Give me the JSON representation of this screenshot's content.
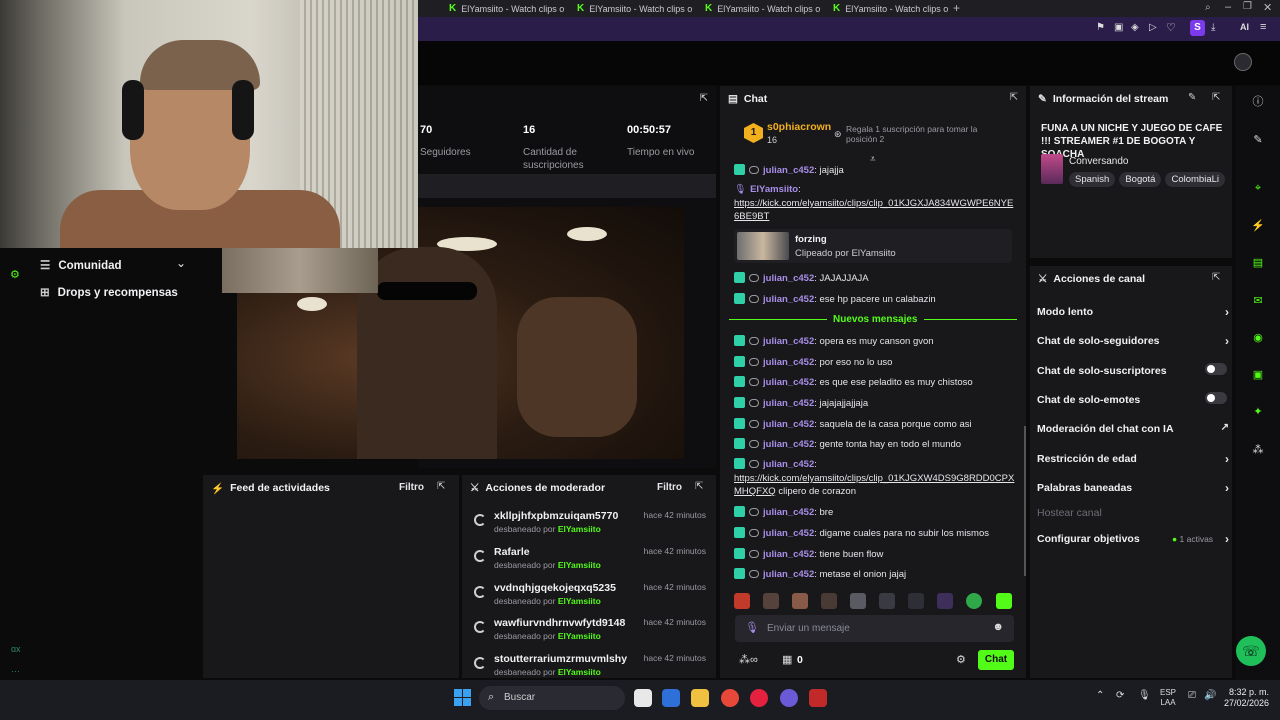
{
  "browser": {
    "tabs": [
      {
        "title": "ElYamsiito - Watch clips o"
      },
      {
        "title": "ElYamsiito - Watch clips o"
      },
      {
        "title": "ElYamsiito - Watch clips o"
      },
      {
        "title": "ElYamsiito - Watch clips o"
      }
    ],
    "new_tab": "+",
    "ai_label": "AI",
    "profile_initial": "S"
  },
  "stats": {
    "followers_value": "70",
    "followers_label": "Seguidores",
    "subs_value": "16",
    "subs_label": "Cantidad de suscripciones",
    "time_value": "00:50:57",
    "time_label": "Tiempo en vivo"
  },
  "sidebar": {
    "community": "Comunidad",
    "drops": "Drops y recompensas"
  },
  "activity": {
    "title": "Feed de actividades",
    "filter": "Filtro"
  },
  "mod_actions": {
    "title": "Acciones de moderador",
    "filter": "Filtro",
    "rows": [
      {
        "name": "xkllpjhfxpbmzuiqam5770",
        "by": "desbaneado por",
        "mod": "ElYamsiito",
        "time": "hace 42 minutos"
      },
      {
        "name": "Rafarle",
        "by": "desbaneado por",
        "mod": "ElYamsiito",
        "time": "hace 42 minutos"
      },
      {
        "name": "vvdnqhjgqekojeqxq5235",
        "by": "desbaneado por",
        "mod": "ElYamsiito",
        "time": "hace 42 minutos"
      },
      {
        "name": "wawfiurvndhrnvwfytd9148",
        "by": "desbaneado por",
        "mod": "ElYamsiito",
        "time": "hace 42 minutos"
      },
      {
        "name": "stoutterrariumzrmuvmlshy",
        "by": "desbaneado por",
        "mod": "ElYamsiito",
        "time": "hace 42 minutos"
      }
    ]
  },
  "chat": {
    "title": "Chat",
    "top_gifter": {
      "rank": "1",
      "name": "s0phiacrown",
      "count": "16",
      "note": "Regala 1 suscripción para tomar la posición 2"
    },
    "pre_messages": [
      {
        "user": "julian_c452",
        "text": "jajajja"
      }
    ],
    "link_message": {
      "user": "ElYamsiito",
      "text": "https://kick.com/elyamsiito/clips/clip_01KJGXJA834WGWPE6NYE6BE9BT"
    },
    "clip_card": {
      "title": "forzing",
      "sub": "Clipeado por ElYamsiito"
    },
    "messages_a": [
      {
        "user": "julian_c452",
        "text": "JAJAJJAJA"
      },
      {
        "user": "julian_c452",
        "text": "ese hp pacere un calabazin"
      }
    ],
    "new_divider": "Nuevos mensajes",
    "messages_b": [
      {
        "user": "julian_c452",
        "text": "opera es muy canson gvon"
      },
      {
        "user": "julian_c452",
        "text": "por eso no lo uso"
      },
      {
        "user": "julian_c452",
        "text": "es que ese peladito es muy chistoso"
      },
      {
        "user": "julian_c452",
        "text": "jajajajjajjaja"
      },
      {
        "user": "julian_c452",
        "text": "saquela de la casa porque como asi"
      },
      {
        "user": "julian_c452",
        "text": "gente tonta hay en todo el mundo"
      }
    ],
    "link_message2": {
      "user": "julian_c452",
      "text": "https://kick.com/elyamsiito/clips/clip_01KJGXW4DS9G8RDD0CPXMHQFXQ",
      "after": "clipero de corazon"
    },
    "messages_c": [
      {
        "user": "julian_c452",
        "text": "bre"
      },
      {
        "user": "julian_c452",
        "text": "digame cuales para no subir los mismos"
      },
      {
        "user": "julian_c452",
        "text": "tiene buen flow"
      },
      {
        "user": "julian_c452",
        "text": "metase el onion jajaj"
      }
    ],
    "input_placeholder": "Enviar un mensaje",
    "points": "0",
    "send_label": "Chat"
  },
  "stream_info": {
    "title": "Información del stream",
    "stream_title": "FUNA A UN NICHE Y JUEGO DE CAFE !!! STREAMER #1 DE BOGOTA Y SOACHA",
    "category": "Conversando",
    "tags": [
      "Spanish",
      "Bogotá",
      "ColombiaLi"
    ]
  },
  "channel_actions": {
    "title": "Acciones de canal",
    "items": [
      {
        "label": "Modo lento"
      },
      {
        "label": "Chat de solo-seguidores"
      },
      {
        "label": "Chat de solo-suscriptores"
      },
      {
        "label": "Chat de solo-emotes"
      },
      {
        "label": "Moderación del chat con IA"
      },
      {
        "label": "Restricción de edad"
      },
      {
        "label": "Palabras baneadas"
      },
      {
        "label": "Hostear canal"
      },
      {
        "label": "Configurar objetivos",
        "badge": "1 activas"
      }
    ]
  },
  "taskbar": {
    "search_label": "Buscar",
    "lang": "ESP",
    "region": "LAA",
    "time": "8:32 p. m.",
    "date": "27/02/2026"
  },
  "colors": {
    "accent": "#53fc18",
    "purple": "#a98ee8",
    "panel": "#18181b"
  }
}
